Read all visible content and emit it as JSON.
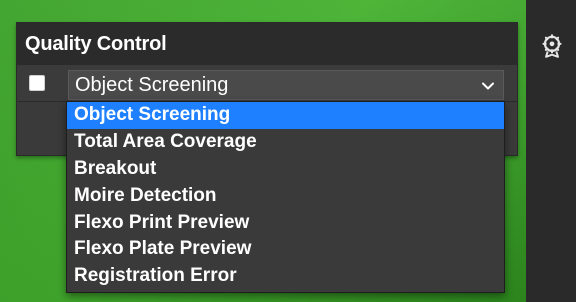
{
  "panel": {
    "title": "Quality Control",
    "checkbox_checked": false,
    "select": {
      "value": "Object Screening",
      "options": [
        "Object Screening",
        "Total Area Coverage",
        "Breakout",
        "Moire Detection",
        "Flexo Print Preview",
        "Flexo Plate Preview",
        "Registration Error"
      ],
      "highlighted_index": 0
    }
  },
  "sidebar": {
    "icon": "badge-settings-icon"
  },
  "colors": {
    "accent": "#1e80ff",
    "background_green": "#44b12e",
    "panel": "#3b3b3b",
    "header": "#2b2b2b"
  }
}
